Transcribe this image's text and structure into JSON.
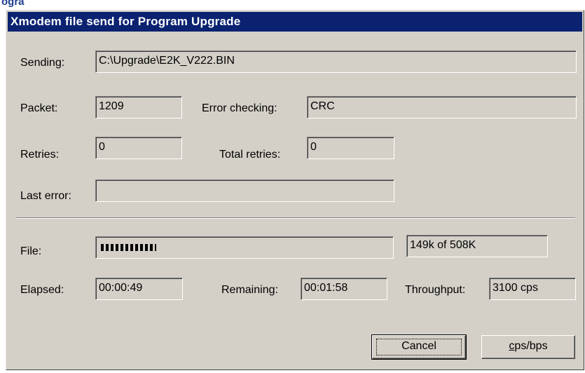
{
  "window": {
    "title": "Xmodem file send for Program Upgrade",
    "clipped_heading": "ogra"
  },
  "fields": {
    "sending_label": "Sending:",
    "sending_value": "C:\\Upgrade\\E2K_V222.BIN",
    "packet_label": "Packet:",
    "packet_value": "1209",
    "error_checking_label": "Error checking:",
    "error_checking_value": "CRC",
    "retries_label": "Retries:",
    "retries_value": "0",
    "total_retries_label": "Total retries:",
    "total_retries_value": "0",
    "last_error_label": "Last error:",
    "last_error_value": ""
  },
  "progress": {
    "file_label": "File:",
    "fraction": 0.293,
    "blocks": 12,
    "size_text": "149k of 508K"
  },
  "timing": {
    "elapsed_label": "Elapsed:",
    "elapsed_value": "00:00:49",
    "remaining_label": "Remaining:",
    "remaining_value": "00:01:58",
    "throughput_label": "Throughput:",
    "throughput_value": "3100 cps"
  },
  "buttons": {
    "cancel": "Cancel",
    "cps_bps_underlined": "c",
    "cps_bps_rest": "ps/bps"
  },
  "colors": {
    "titlebar": "#0a2270",
    "dialog_bg": "#d4d0c8"
  }
}
